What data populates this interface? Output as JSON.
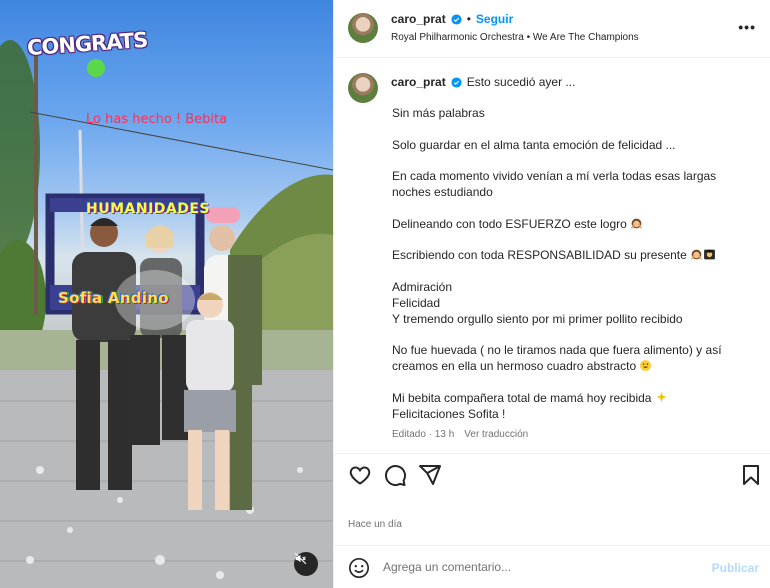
{
  "photo": {
    "overlay_congrats": "CONGRATS",
    "overlay_caption": "Lo has hecho ! Bebita",
    "frame_top_text": "HUMANIDADES",
    "frame_bottom_text": "Sofia Andino",
    "mute_icon": "speaker-muted-icon"
  },
  "header": {
    "username": "caro_prat",
    "separator": "•",
    "follow_label": "Seguir",
    "audio": "Royal Philharmonic Orchestra • We Are The Champions",
    "more_label": "•••"
  },
  "caption": {
    "username": "caro_prat",
    "first_line": "Esto sucedió ayer ...",
    "paragraphs": [
      "Sin más palabras",
      "Solo guardar en el alma tanta emoción de felicidad ...",
      "En cada momento vivido venían a mí verla todas esas largas noches estudiando",
      "Delineando con todo ESFUERZO este logro",
      "Escribiendo con toda RESPONSABILIDAD su presente",
      "Admiración\nFelicidad\nY tremendo orgullo siento por mi primer pollito recibido",
      "No fue huevada ( no le tiramos nada que fuera alimento) y así creamos en ella un hermoso cuadro abstracto",
      "Mi bebita compañera total de mamá hoy recibida\nFelicitaciones Sofita !"
    ],
    "edited": "Editado · 13 h",
    "translate": "Ver traducción"
  },
  "actions": {
    "like_icon": "heart-icon",
    "comment_icon": "comment-icon",
    "share_icon": "send-icon",
    "save_icon": "bookmark-icon"
  },
  "timestamp": "Hace un día",
  "comment": {
    "placeholder": "Agrega un comentario...",
    "publish_label": "Publicar"
  },
  "colors": {
    "accent": "#0095f6",
    "publish_disabled": "#b3dbff",
    "secondary_text": "#737373",
    "divider": "#efefef"
  }
}
